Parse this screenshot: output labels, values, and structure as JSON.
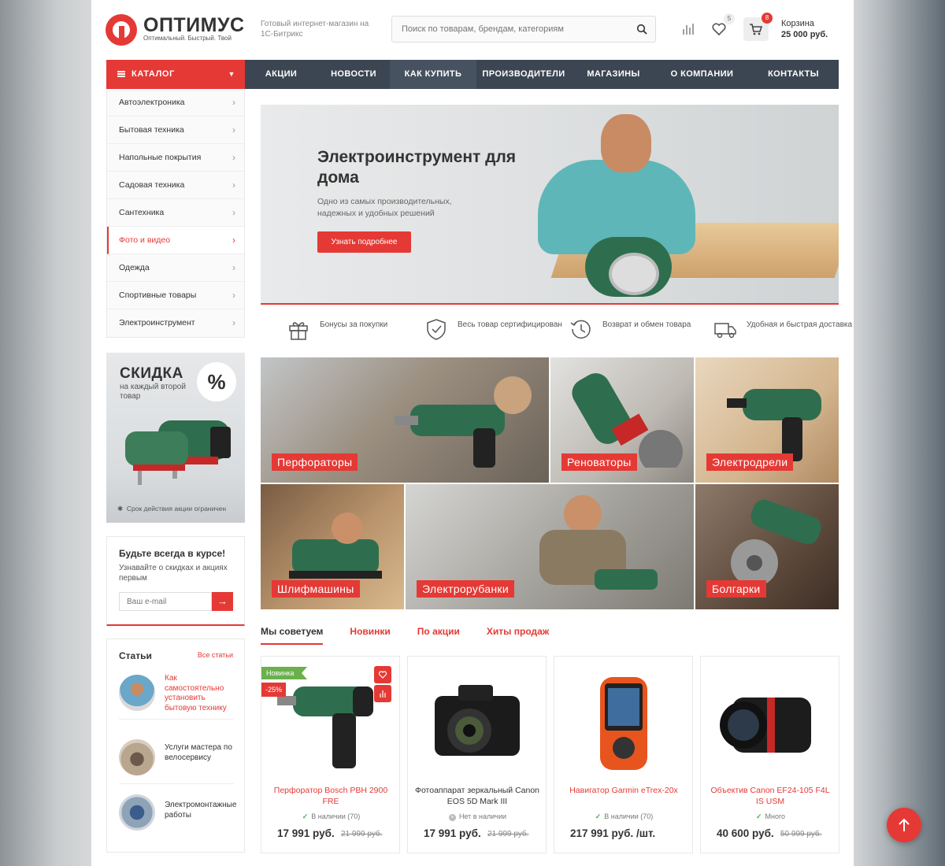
{
  "header": {
    "logo_name": "ОПТИМУС",
    "logo_tagline": "Оптимальный. Быстрый. Твой",
    "tagline": "Готовый интернет-магазин на 1С-Битрикс",
    "search_placeholder": "Поиск по товарам, брендам, категориям",
    "favorites_count": "5",
    "cart_count": "8",
    "cart_label": "Корзина",
    "cart_sum": "25 000 руб."
  },
  "nav": {
    "catalog_label": "КАТАЛОГ",
    "items": [
      "АКЦИИ",
      "НОВОСТИ",
      "КАК КУПИТЬ",
      "ПРОИЗВОДИТЕЛИ",
      "МАГАЗИНЫ",
      "О КОМПАНИИ",
      "КОНТАКТЫ"
    ]
  },
  "catalog": {
    "items": [
      "Автоэлектроника",
      "Бытовая техника",
      "Напольные покрытия",
      "Садовая техника",
      "Сантехника",
      "Фото и видео",
      "Одежда",
      "Спортивные товары",
      "Электроинструмент"
    ],
    "active_index": 5
  },
  "promo": {
    "title": "СКИДКА",
    "subtitle": "на каждый второй товар",
    "badge": "%",
    "note": "Срок действия акции ограничен"
  },
  "subscribe": {
    "title": "Будьте всегда в курсе!",
    "text": "Узнавайте о скидках и акциях первым",
    "placeholder": "Ваш e-mail"
  },
  "articles": {
    "title": "Статьи",
    "all_link": "Все статьи",
    "items": [
      "Как самостоятельно установить бытовую технику",
      "Услуги мастера по велосервису",
      "Электромонтажные работы"
    ]
  },
  "hero": {
    "title": "Электроинструмент для дома",
    "subtitle": "Одно из самых производительных, надежных и удобных решений",
    "button": "Узнать подробнее"
  },
  "advantages": [
    {
      "icon": "gift-icon",
      "text": "Бонусы за покупки"
    },
    {
      "icon": "certificate-icon",
      "text": "Весь товар сертифицирован"
    },
    {
      "icon": "clock-return-icon",
      "text": "Возврат и обмен товара"
    },
    {
      "icon": "truck-icon",
      "text": "Удобная и быстрая доставка"
    }
  ],
  "categories": [
    "Перфораторы",
    "Реноваторы",
    "Электродрели",
    "Шлифмашины",
    "Электрорубанки",
    "Болгарки"
  ],
  "tabs": [
    "Мы советуем",
    "Новинки",
    "По акции",
    "Хиты продаж"
  ],
  "products": [
    {
      "name": "Перфоратор Bosch PBH 2900 FRE",
      "stock": "В наличии (70)",
      "price": "17 991 руб.",
      "old_price": "21 999 руб.",
      "flag": "Новинка",
      "discount": "-25%"
    },
    {
      "name": "Фотоаппарат зеркальный Canon EOS 5D Mark III",
      "stock": "Нет в наличии",
      "price": "17 991 руб.",
      "old_price": "21 999 руб."
    },
    {
      "name": "Навигатор Garmin eTrex-20x",
      "stock": "В наличии (70)",
      "price": "217 991 руб. /шт.",
      "old_price": ""
    },
    {
      "name": "Объектив Canon EF24-105 F4L IS USM",
      "stock": "Много",
      "price": "40 600 руб.",
      "old_price": "50 999 руб."
    }
  ],
  "colors": {
    "accent": "#e53935",
    "nav_bg": "#3c4652",
    "in_stock": "#4caf50"
  }
}
